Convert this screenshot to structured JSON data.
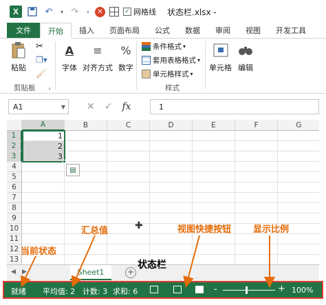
{
  "titlebar": {
    "app_icon": "X",
    "gridlines_label": "网格线",
    "doc_title": "状态栏.xlsx -"
  },
  "ribbon_tabs": [
    {
      "label": "文件"
    },
    {
      "label": "开始"
    },
    {
      "label": "插入"
    },
    {
      "label": "页面布局"
    },
    {
      "label": "公式"
    },
    {
      "label": "数据"
    },
    {
      "label": "审阅"
    },
    {
      "label": "视图"
    },
    {
      "label": "开发工具"
    }
  ],
  "ribbon": {
    "paste": "粘贴",
    "clipboard_group": "剪贴板",
    "font": "字体",
    "alignment": "对齐方式",
    "number": "数字",
    "number_icon": "%",
    "conditional_format": "条件格式",
    "table_format": "套用表格格式",
    "cell_style": "单元格样式",
    "styles_group": "样式",
    "cells": "单元格",
    "editing": "编辑"
  },
  "formula_bar": {
    "name_box": "A1",
    "fx": "fx",
    "value": "1"
  },
  "grid": {
    "columns": [
      "A",
      "B",
      "C",
      "D",
      "E",
      "F",
      "G"
    ],
    "rows": [
      "1",
      "2",
      "3",
      "4",
      "5",
      "6",
      "7",
      "8",
      "9",
      "10",
      "11",
      "12",
      "13"
    ],
    "cells": {
      "A1": "1",
      "A2": "2",
      "A3": "3"
    }
  },
  "sheet_tabs": {
    "active": "Sheet1",
    "add": "+",
    "nav_prev": "◀",
    "nav_next": "▶"
  },
  "status_bar": {
    "mode": "就绪",
    "average": "平均值: 2",
    "count": "计数: 3",
    "sum": "求和: 6",
    "zoom": "100%",
    "zoom_minus": "-",
    "zoom_plus": "+"
  },
  "annotations": {
    "current_status": "当前状态",
    "summary": "汇总值",
    "view_shortcuts": "视图快捷按钮",
    "zoom_ratio": "显示比例",
    "status_bar_title": "状态栏"
  },
  "colors": {
    "excel_green": "#217346",
    "annotation_orange": "#e46c0a",
    "highlight_red": "#e03a2d"
  }
}
